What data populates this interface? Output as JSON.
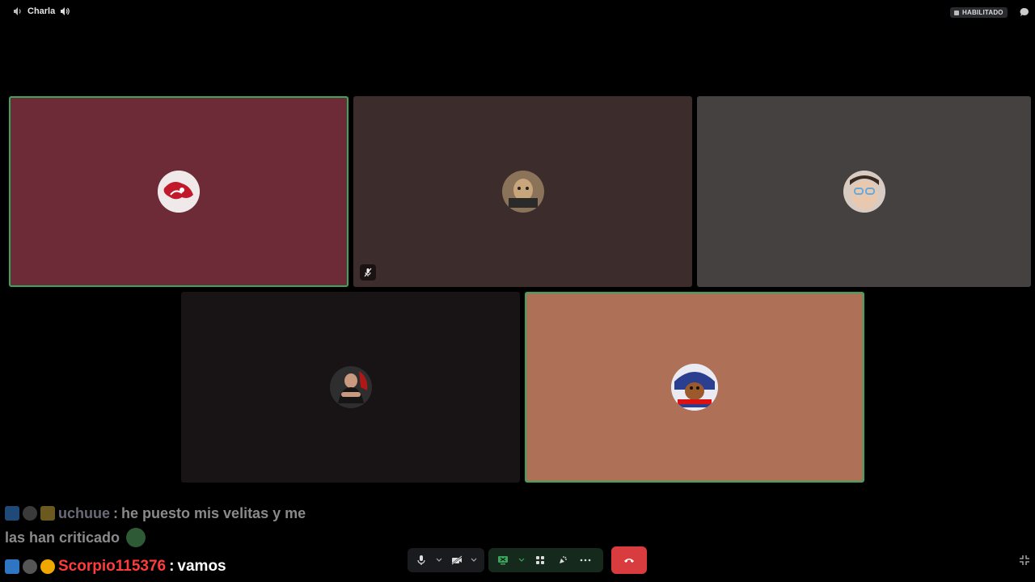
{
  "topbar": {
    "channel_name": "Charla",
    "enabled_badge": "HABILITADO"
  },
  "tiles": [
    {
      "id": "tile-1",
      "bg": "#6d2a37",
      "speaking": true,
      "muted": false
    },
    {
      "id": "tile-2",
      "bg": "#3d2c2c",
      "speaking": false,
      "muted": true
    },
    {
      "id": "tile-3",
      "bg": "#454140",
      "speaking": false,
      "muted": false
    },
    {
      "id": "tile-4",
      "bg": "#181315",
      "speaking": false,
      "muted": false
    },
    {
      "id": "tile-5",
      "bg": "#ae7158",
      "speaking": true,
      "muted": false
    }
  ],
  "chat": {
    "messages": [
      {
        "user": "uchuue",
        "separator": ":",
        "text_line1": "he puesto mis velitas y me",
        "text_line2": "las han criticado"
      },
      {
        "user": "Scorpio115376",
        "separator": ":",
        "text": "vamos"
      }
    ]
  },
  "controls": {
    "microphone": "microphone-icon",
    "camera": "camera-off-icon",
    "share": "screen-share-icon",
    "activities": "activities-icon",
    "soundboard": "soundboard-icon",
    "more": "more-icon",
    "disconnect": "hang-up-icon"
  },
  "colors": {
    "speaking_border": "#3ba55d",
    "hangup": "#d83c3e",
    "chat_user_active": "#ff3b3b"
  }
}
